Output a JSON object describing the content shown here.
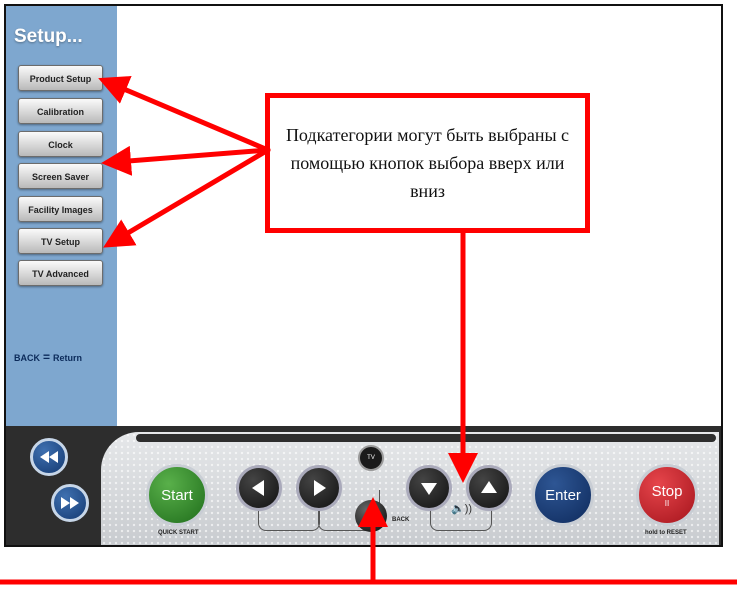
{
  "sidebar": {
    "title": "Setup...",
    "items": [
      {
        "label": "Product Setup"
      },
      {
        "label": "Calibration"
      },
      {
        "label": "Clock"
      },
      {
        "label": "Screen Saver"
      },
      {
        "label": "Facility Images"
      },
      {
        "label": "TV Setup"
      },
      {
        "label": "TV Advanced"
      }
    ],
    "back_key": "BACK",
    "back_action": "Return"
  },
  "remote": {
    "start_label": "Start",
    "start_caption": "QUICK START",
    "tv_label": "TV",
    "back_label": "BACK",
    "enter_label": "Enter",
    "stop_label": "Stop",
    "stop_symbol": "II",
    "stop_caption": "hold to RESET",
    "volume_symbol": "🔈))"
  },
  "callout": {
    "text": "Подкатегории могут быть выбраны с помощью кнопок выбора вверх или вниз"
  },
  "colors": {
    "annotation": "#ff0000",
    "sidebar": "#7ea7cf"
  }
}
